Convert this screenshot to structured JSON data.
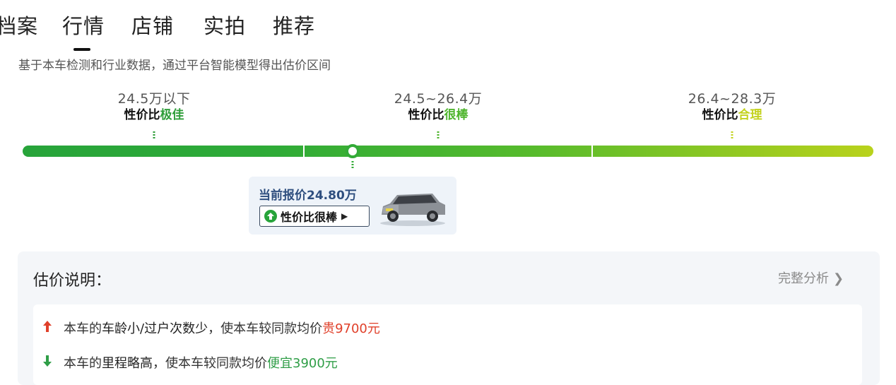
{
  "tabs": [
    {
      "label": "档案",
      "active": false
    },
    {
      "label": "行情",
      "active": true
    },
    {
      "label": "店铺",
      "active": false
    },
    {
      "label": "实拍",
      "active": false
    },
    {
      "label": "推荐",
      "active": false
    }
  ],
  "description": "基于本车检测和行业数据，通过平台智能模型得出估价区间",
  "price_bands": [
    {
      "range": "24.5万以下",
      "prefix": "性价比",
      "rating": "极佳",
      "color": "#2f9e3a"
    },
    {
      "range": "24.5~26.4万",
      "prefix": "性价比",
      "rating": "很棒",
      "color": "#4fb52e"
    },
    {
      "range": "26.4~28.3万",
      "prefix": "性价比",
      "rating": "合理",
      "color": "#c3d21e"
    }
  ],
  "current": {
    "price_label": "当前报价24.80万",
    "badge": "性价比很棒",
    "position_fraction": 0.388
  },
  "explanation": {
    "title": "估价说明：",
    "full_analysis": "完整分析",
    "rows": [
      {
        "direction": "up",
        "prefix": "本车的",
        "factor": "车龄小/过户次数少",
        "middle": "，使本车较同款均价",
        "effect": "贵9700元"
      },
      {
        "direction": "down",
        "prefix": "本车的",
        "factor": "里程略高",
        "middle": "，使本车较同款均价",
        "effect": "便宜3900元"
      }
    ]
  },
  "colors": {
    "up": "#e0402a",
    "down": "#2f9e47",
    "bar_start": "#27a43a",
    "bar_end": "#b9d21c"
  }
}
